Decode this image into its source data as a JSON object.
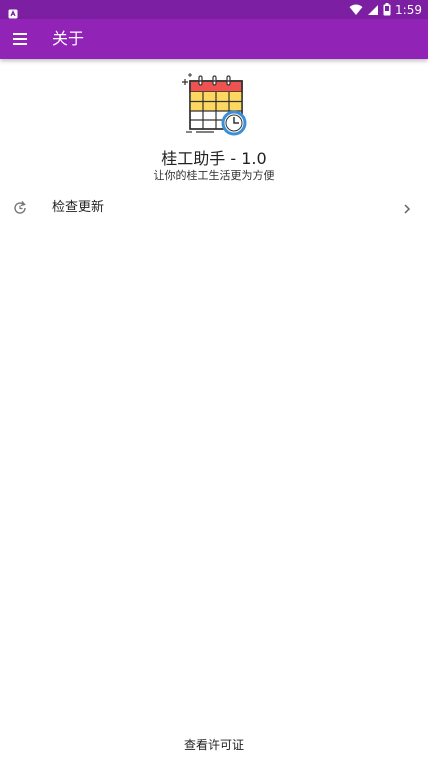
{
  "status_bar": {
    "time": "1:59",
    "icons": [
      "notification-icon",
      "wifi-icon",
      "signal-icon",
      "battery-icon"
    ],
    "color": "#7d1fa3"
  },
  "app_bar": {
    "title": "关于",
    "color": "#9124b6",
    "menu_icon": "menu-icon"
  },
  "header": {
    "app_name": "桂工助手 - 1.0",
    "slogan": "让你的桂工生活更为方便",
    "logo_icon": "calendar-clock-icon"
  },
  "list": {
    "items": [
      {
        "label": "检查更新",
        "icon": "refresh-icon",
        "trailing_icon": "chevron-right-icon"
      }
    ]
  },
  "footer": {
    "license_label": "查看许可证"
  }
}
